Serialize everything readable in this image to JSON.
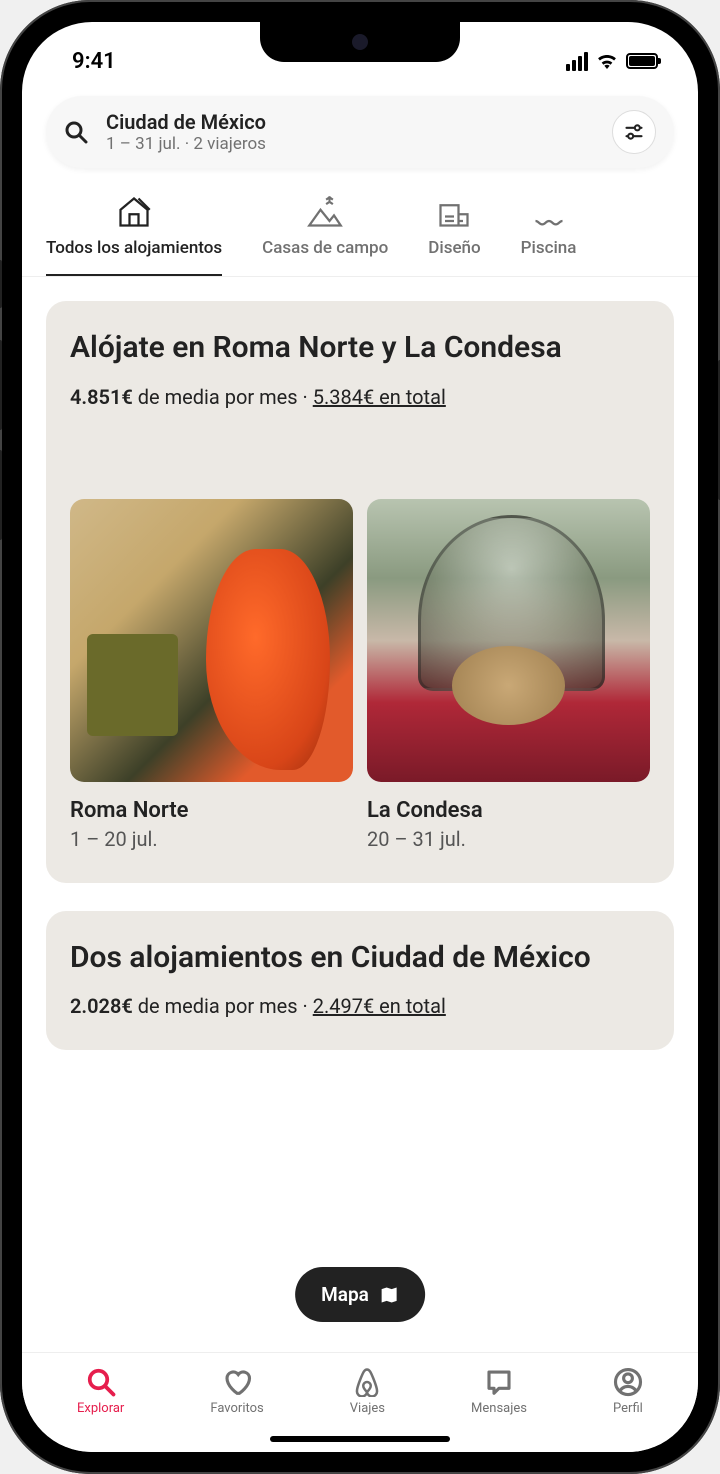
{
  "status": {
    "time": "9:41"
  },
  "search": {
    "destination": "Ciudad de México",
    "details": "1 – 31 jul. · 2 viajeros"
  },
  "tabs": [
    {
      "label": "Todos los alojamientos"
    },
    {
      "label": "Casas de campo"
    },
    {
      "label": "Diseño"
    },
    {
      "label": "Piscina"
    }
  ],
  "card1": {
    "title": "Alójate en Roma Norte y La Condesa",
    "price_bold": "4.851€",
    "price_mid": " de media por mes · ",
    "price_total": "5.384€ en total",
    "listings": [
      {
        "name": "Roma Norte",
        "dates": "1 – 20 jul."
      },
      {
        "name": "La Condesa",
        "dates": "20 – 31 jul."
      }
    ]
  },
  "card2": {
    "title": "Dos alojamientos en Ciudad de México",
    "price_bold": "2.028€",
    "price_mid": " de media por mes · ",
    "price_total": "2.497€ en total"
  },
  "map_button": "Mapa",
  "nav": {
    "explorar": "Explorar",
    "favoritos": "Favoritos",
    "viajes": "Viajes",
    "mensajes": "Mensajes",
    "perfil": "Perfil"
  }
}
